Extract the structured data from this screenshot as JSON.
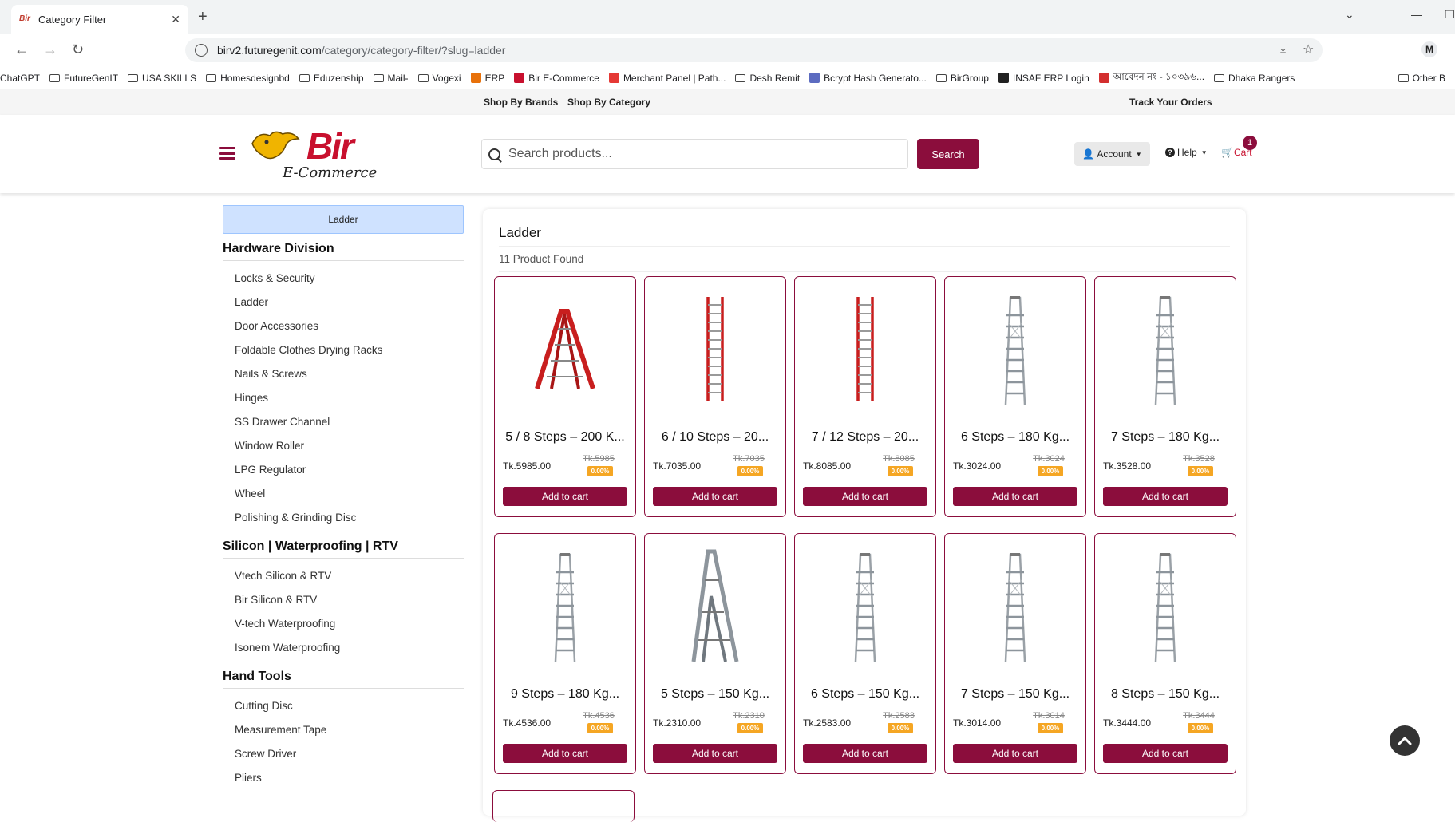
{
  "browser": {
    "tab_title": "Category Filter",
    "url_host": "birv2.futuregenit.com",
    "url_path": "/category/category-filter/?slug=ladder",
    "profile_letter": "M",
    "bookmarks": [
      {
        "label": "ChatGPT",
        "type": "none"
      },
      {
        "label": "FutureGenIT",
        "type": "folder"
      },
      {
        "label": "USA SKILLS",
        "type": "folder"
      },
      {
        "label": "Homesdesignbd",
        "type": "folder"
      },
      {
        "label": "Eduzenship",
        "type": "folder"
      },
      {
        "label": "Mail-",
        "type": "folder"
      },
      {
        "label": "Vogexi",
        "type": "folder"
      },
      {
        "label": "ERP",
        "type": "gear"
      },
      {
        "label": "Bir E-Commerce",
        "type": "bir"
      },
      {
        "label": "Merchant Panel | Path...",
        "type": "pathao"
      },
      {
        "label": "Desh Remit",
        "type": "folder"
      },
      {
        "label": "Bcrypt Hash Generato...",
        "type": "bcrypt"
      },
      {
        "label": "BirGroup",
        "type": "folder"
      },
      {
        "label": "INSAF ERP Login",
        "type": "insaf"
      },
      {
        "label": "আবেদন নং - ১০৩৯৬...",
        "type": "gov"
      },
      {
        "label": "Dhaka Rangers",
        "type": "folder"
      }
    ],
    "other_bookmarks": "Other B"
  },
  "topbar": {
    "shop_by_brands": "Shop By Brands",
    "shop_by_category": "Shop By Category",
    "track_orders": "Track Your Orders"
  },
  "header": {
    "logo_brand": "Bir",
    "logo_sub": "E-Commerce",
    "search_placeholder": "Search products...",
    "search_button": "Search",
    "account": "Account",
    "help": "Help",
    "cart": "Cart",
    "cart_count": "1"
  },
  "sidebar": {
    "active": "Ladder",
    "divisions": [
      {
        "title": "Hardware Division",
        "items": [
          "Locks & Security",
          "Ladder",
          "Door Accessories",
          "Foldable Clothes Drying Racks",
          "Nails & Screws",
          "Hinges",
          "SS Drawer Channel",
          "Window Roller",
          "LPG Regulator",
          "Wheel",
          "Polishing & Grinding Disc"
        ]
      },
      {
        "title": "Silicon | Waterproofing | RTV",
        "items": [
          "Vtech Silicon & RTV",
          "Bir Silicon & RTV",
          "V-tech Waterproofing",
          "Isonem Waterproofing"
        ]
      },
      {
        "title": "Hand Tools",
        "items": [
          "Cutting Disc",
          "Measurement Tape",
          "Screw Driver",
          "Pliers"
        ]
      }
    ]
  },
  "content": {
    "title": "Ladder",
    "count": "11 Product Found",
    "add_to_cart": "Add to cart",
    "products": [
      {
        "name": "5 / 8 Steps – 200 K...",
        "price": "Tk.5985.00",
        "old": "Tk.5985",
        "disc": "0.00%",
        "img": "red-a"
      },
      {
        "name": "6 / 10 Steps – 20...",
        "price": "Tk.7035.00",
        "old": "Tk.7035",
        "disc": "0.00%",
        "img": "red-straight"
      },
      {
        "name": "7 / 12 Steps – 20...",
        "price": "Tk.8085.00",
        "old": "Tk.8085",
        "disc": "0.00%",
        "img": "red-straight"
      },
      {
        "name": "6 Steps – 180 Kg...",
        "price": "Tk.3024.00",
        "old": "Tk.3024",
        "disc": "0.00%",
        "img": "silver"
      },
      {
        "name": "7 Steps – 180 Kg...",
        "price": "Tk.3528.00",
        "old": "Tk.3528",
        "disc": "0.00%",
        "img": "silver"
      },
      {
        "name": "9 Steps – 180 Kg...",
        "price": "Tk.4536.00",
        "old": "Tk.4536",
        "disc": "0.00%",
        "img": "silver"
      },
      {
        "name": "5 Steps – 150 Kg...",
        "price": "Tk.2310.00",
        "old": "Tk.2310",
        "disc": "0.00%",
        "img": "silver-a"
      },
      {
        "name": "6 Steps – 150 Kg...",
        "price": "Tk.2583.00",
        "old": "Tk.2583",
        "disc": "0.00%",
        "img": "silver"
      },
      {
        "name": "7 Steps – 150 Kg...",
        "price": "Tk.3014.00",
        "old": "Tk.3014",
        "disc": "0.00%",
        "img": "silver"
      },
      {
        "name": "8 Steps – 150 Kg...",
        "price": "Tk.3444.00",
        "old": "Tk.3444",
        "disc": "0.00%",
        "img": "silver"
      }
    ]
  },
  "colors": {
    "brand": "#8b0d3c",
    "accent_red": "#c8102e",
    "discount": "#f5a623",
    "active_cat": "#cfe2ff"
  }
}
